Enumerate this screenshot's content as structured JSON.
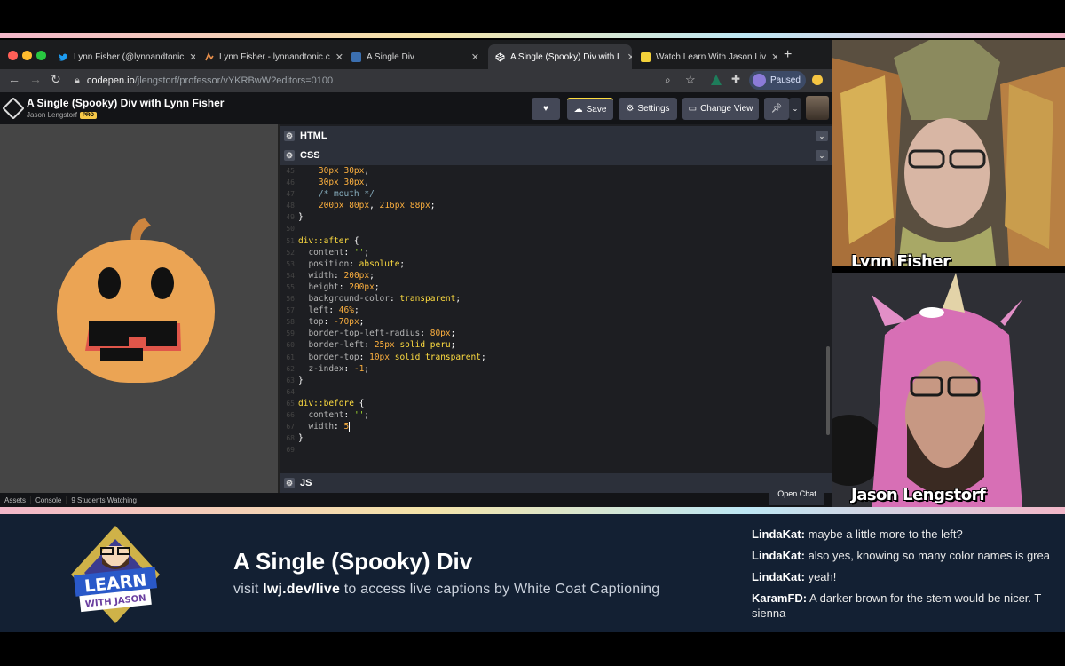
{
  "browser": {
    "tabs": [
      {
        "label": "Lynn Fisher (@lynnandtonic",
        "icon": "twitter-icon"
      },
      {
        "label": "Lynn Fisher - lynnandtonic.c",
        "icon": "lynn-site-icon"
      },
      {
        "label": "A Single Div",
        "icon": "asingle-div-icon"
      },
      {
        "label": "A Single (Spooky) Div with L",
        "icon": "codepen-icon"
      },
      {
        "label": "Watch Learn With Jason Liv",
        "icon": "learn-with-jason-icon"
      }
    ],
    "new_tab": "+",
    "url_host": "codepen.io",
    "url_path": "/jlengstorf/professor/vYKRBwW?editors=0100",
    "paused_label": "Paused"
  },
  "codepen": {
    "title": "A Single (Spooky) Div with Lynn Fisher",
    "author": "Jason Lengstorf",
    "pro_badge": "PRO",
    "save_label": "Save",
    "settings_label": "Settings",
    "change_view_label": "Change View",
    "panels": {
      "html": "HTML",
      "css": "CSS",
      "js": "JS"
    },
    "css_lines": [
      {
        "n": "45",
        "parts": [
          [
            "num",
            "    30px 30px"
          ],
          [
            "ct",
            ","
          ]
        ]
      },
      {
        "n": "46",
        "parts": [
          [
            "num",
            "    30px 30px"
          ],
          [
            "ct",
            ","
          ]
        ]
      },
      {
        "n": "47",
        "parts": [
          [
            "cmt",
            "    /* mouth */"
          ]
        ]
      },
      {
        "n": "48",
        "parts": [
          [
            "num",
            "    200px 80px"
          ],
          [
            "ct",
            ", "
          ],
          [
            "num",
            "216px 88px"
          ],
          [
            "ct",
            ";"
          ]
        ]
      },
      {
        "n": "49",
        "parts": [
          [
            "ct",
            "}"
          ]
        ]
      },
      {
        "n": "50",
        "parts": []
      },
      {
        "n": "51",
        "parts": [
          [
            "sel",
            "div::after"
          ],
          [
            "ct",
            " {"
          ]
        ]
      },
      {
        "n": "52",
        "parts": [
          [
            "prop",
            "  content"
          ],
          [
            "ct",
            ": "
          ],
          [
            "str",
            "''"
          ],
          [
            "ct",
            ";"
          ]
        ]
      },
      {
        "n": "53",
        "parts": [
          [
            "prop",
            "  position"
          ],
          [
            "ct",
            ": "
          ],
          [
            "kw",
            "absolute"
          ],
          [
            "ct",
            ";"
          ]
        ]
      },
      {
        "n": "54",
        "parts": [
          [
            "prop",
            "  width"
          ],
          [
            "ct",
            ": "
          ],
          [
            "num",
            "200px"
          ],
          [
            "ct",
            ";"
          ]
        ]
      },
      {
        "n": "55",
        "parts": [
          [
            "prop",
            "  height"
          ],
          [
            "ct",
            ": "
          ],
          [
            "num",
            "200px"
          ],
          [
            "ct",
            ";"
          ]
        ]
      },
      {
        "n": "56",
        "parts": [
          [
            "prop",
            "  background-color"
          ],
          [
            "ct",
            ": "
          ],
          [
            "kw",
            "transparent"
          ],
          [
            "ct",
            ";"
          ]
        ]
      },
      {
        "n": "57",
        "parts": [
          [
            "prop",
            "  left"
          ],
          [
            "ct",
            ": "
          ],
          [
            "num",
            "46%"
          ],
          [
            "ct",
            ";"
          ]
        ]
      },
      {
        "n": "58",
        "parts": [
          [
            "prop",
            "  top"
          ],
          [
            "ct",
            ": "
          ],
          [
            "num",
            "-70px"
          ],
          [
            "ct",
            ";"
          ]
        ]
      },
      {
        "n": "59",
        "parts": [
          [
            "prop",
            "  border-top-left-radius"
          ],
          [
            "ct",
            ": "
          ],
          [
            "num",
            "80px"
          ],
          [
            "ct",
            ";"
          ]
        ]
      },
      {
        "n": "60",
        "parts": [
          [
            "prop",
            "  border-left"
          ],
          [
            "ct",
            ": "
          ],
          [
            "num",
            "25px"
          ],
          [
            "ct",
            " "
          ],
          [
            "kw",
            "solid peru"
          ],
          [
            "ct",
            ";"
          ]
        ]
      },
      {
        "n": "61",
        "parts": [
          [
            "prop",
            "  border-top"
          ],
          [
            "ct",
            ": "
          ],
          [
            "num",
            "10px"
          ],
          [
            "ct",
            " "
          ],
          [
            "kw",
            "solid transparent"
          ],
          [
            "ct",
            ";"
          ]
        ]
      },
      {
        "n": "62",
        "parts": [
          [
            "prop",
            "  z-index"
          ],
          [
            "ct",
            ": "
          ],
          [
            "num",
            "-1"
          ],
          [
            "ct",
            ";"
          ]
        ]
      },
      {
        "n": "63",
        "parts": [
          [
            "ct",
            "}"
          ]
        ]
      },
      {
        "n": "64",
        "parts": []
      },
      {
        "n": "65",
        "parts": [
          [
            "sel",
            "div::before"
          ],
          [
            "ct",
            " {"
          ]
        ]
      },
      {
        "n": "66",
        "parts": [
          [
            "prop",
            "  content"
          ],
          [
            "ct",
            ": "
          ],
          [
            "str",
            "''"
          ],
          [
            "ct",
            ";"
          ]
        ]
      },
      {
        "n": "67",
        "parts": [
          [
            "prop",
            "  width"
          ],
          [
            "ct",
            ": "
          ],
          [
            "num",
            "5"
          ]
        ],
        "cursor": true
      },
      {
        "n": "68",
        "parts": [
          [
            "ct",
            "}"
          ]
        ]
      },
      {
        "n": "69",
        "parts": []
      }
    ],
    "footer": {
      "assets": "Assets",
      "console": "Console",
      "watching": "9 Students Watching"
    },
    "open_chat": "Open Chat"
  },
  "cams": {
    "guest_name": "Lynn Fisher",
    "host_name": "Jason Lengstorf"
  },
  "banner": {
    "logo_top": "LEARN",
    "logo_bottom": "WITH JASON",
    "title": "A Single (Spooky) Div",
    "caption_prefix": "visit ",
    "caption_link": "lwj.dev/live",
    "caption_suffix": " to access live captions by White Coat Captioning",
    "chat": [
      {
        "user": "LindaKat:",
        "msg": " maybe a little more to the left?"
      },
      {
        "user": "LindaKat:",
        "msg": " also yes, knowing so many color names is grea"
      },
      {
        "user": "LindaKat:",
        "msg": " yeah!"
      },
      {
        "user": "KaramFD:",
        "msg": " A darker brown for the stem would be nicer. T"
      },
      {
        "user": "",
        "msg": "sienna"
      }
    ]
  },
  "colors": {
    "pumpkin": "#eba454",
    "stem": "#cd853f",
    "mouth_shadow": "#e0564a",
    "banner_bg": "#132033",
    "accent": "#ffdd40"
  }
}
